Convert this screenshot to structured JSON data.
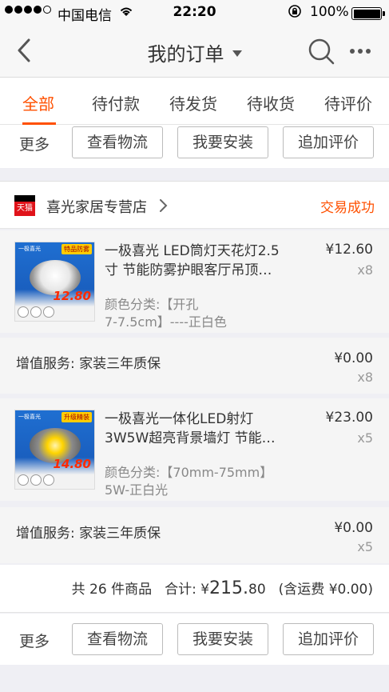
{
  "status_bar": {
    "carrier": "中国电信",
    "time": "22:20",
    "battery": "100%"
  },
  "nav": {
    "title": "我的订单"
  },
  "tabs": [
    "全部",
    "待付款",
    "待发货",
    "待收货",
    "待评价"
  ],
  "active_tab": "全部",
  "actions": {
    "more": "更多",
    "logistics": "查看物流",
    "install": "我要安装",
    "review": "追加评价"
  },
  "order": {
    "store_name": "喜光家居专营店",
    "status": "交易成功",
    "items": [
      {
        "name_line1": "一极喜光 LED筒灯天花灯2.5",
        "name_line2": "寸 节能防雾护眼客厅吊顶…",
        "variant_line1": "颜色分类:【开孔",
        "variant_line2": "7-7.5cm】----正白色",
        "price": "¥12.60",
        "qty": "x8",
        "thumb_badge": "12.80",
        "thumb_ribbon": "特品防雾",
        "thumb_brand": "一极喜光"
      },
      {
        "name_line1": "一极喜光一体化LED射灯",
        "name_line2": "3W5W超亮背景墙灯 节能…",
        "variant_line1": "颜色分类:【70mm-75mm】",
        "variant_line2": "5W-正白光",
        "price": "¥23.00",
        "qty": "x5",
        "thumb_badge": "14.80",
        "thumb_ribbon": "升级精装",
        "thumb_brand": "一极喜光"
      }
    ],
    "services": [
      {
        "label": "增值服务:  家装三年质保",
        "price": "¥0.00",
        "qty": "x8"
      },
      {
        "label": "增值服务:  家装三年质保",
        "price": "¥0.00",
        "qty": "x5"
      }
    ],
    "summary": {
      "count_text": "共 26 件商品",
      "total_label": "合计: ¥",
      "total_int": "215.",
      "total_dec": "80",
      "shipping": "(含运费 ¥0.00)"
    }
  },
  "colors": {
    "accent": "#ff5000",
    "background": "#efeff4"
  }
}
